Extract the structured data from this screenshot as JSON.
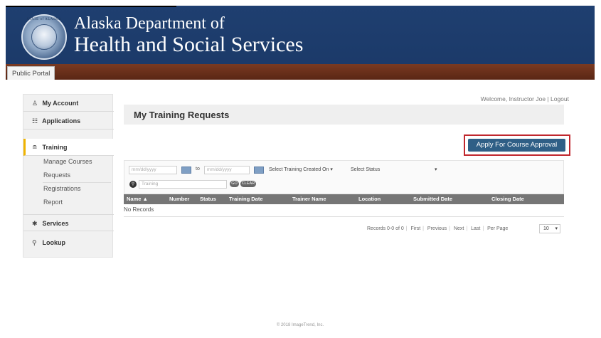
{
  "header": {
    "seal_text": "STATE of ALASKA",
    "title_line1": "Alaska Department of",
    "title_line2": "Health and Social Services"
  },
  "portal_tab": "Public Portal",
  "welcome": "Welcome, Instructor Joe | Logout",
  "sidebar": {
    "items": [
      {
        "label": "My Account",
        "icon": "user-icon"
      },
      {
        "label": "Applications",
        "icon": "applications-icon"
      },
      {
        "label": "Training",
        "icon": "training-icon"
      },
      {
        "label": "Services",
        "icon": "gear-icon"
      },
      {
        "label": "Lookup",
        "icon": "search-icon"
      }
    ],
    "training_sub": [
      "Manage Courses",
      "Requests",
      "Registrations",
      "Report"
    ]
  },
  "page_title": "My Training Requests",
  "apply_button": "Apply For Course Approval",
  "filters": {
    "date_from_placeholder": "mm/dd/yyyy",
    "to_label": "to",
    "date_to_placeholder": "mm/dd/yyyy",
    "date_type_select": "Select Training Created On",
    "status_select": "Select Status",
    "search_placeholder": "Training",
    "go_label": "GO",
    "clear_label": "CLEAR"
  },
  "table": {
    "columns": [
      "Name ▲",
      "Number",
      "Status",
      "Training Date",
      "Trainer Name",
      "Location",
      "Submitted Date",
      "Closing Date"
    ],
    "empty_text": "No Records"
  },
  "pager": {
    "records": "Records 0-0 of 0",
    "first": "First",
    "previous": "Previous",
    "next": "Next",
    "last": "Last",
    "per_page": "Per Page",
    "per_page_value": "10"
  },
  "footer": "© 2018 ImageTrend, Inc."
}
